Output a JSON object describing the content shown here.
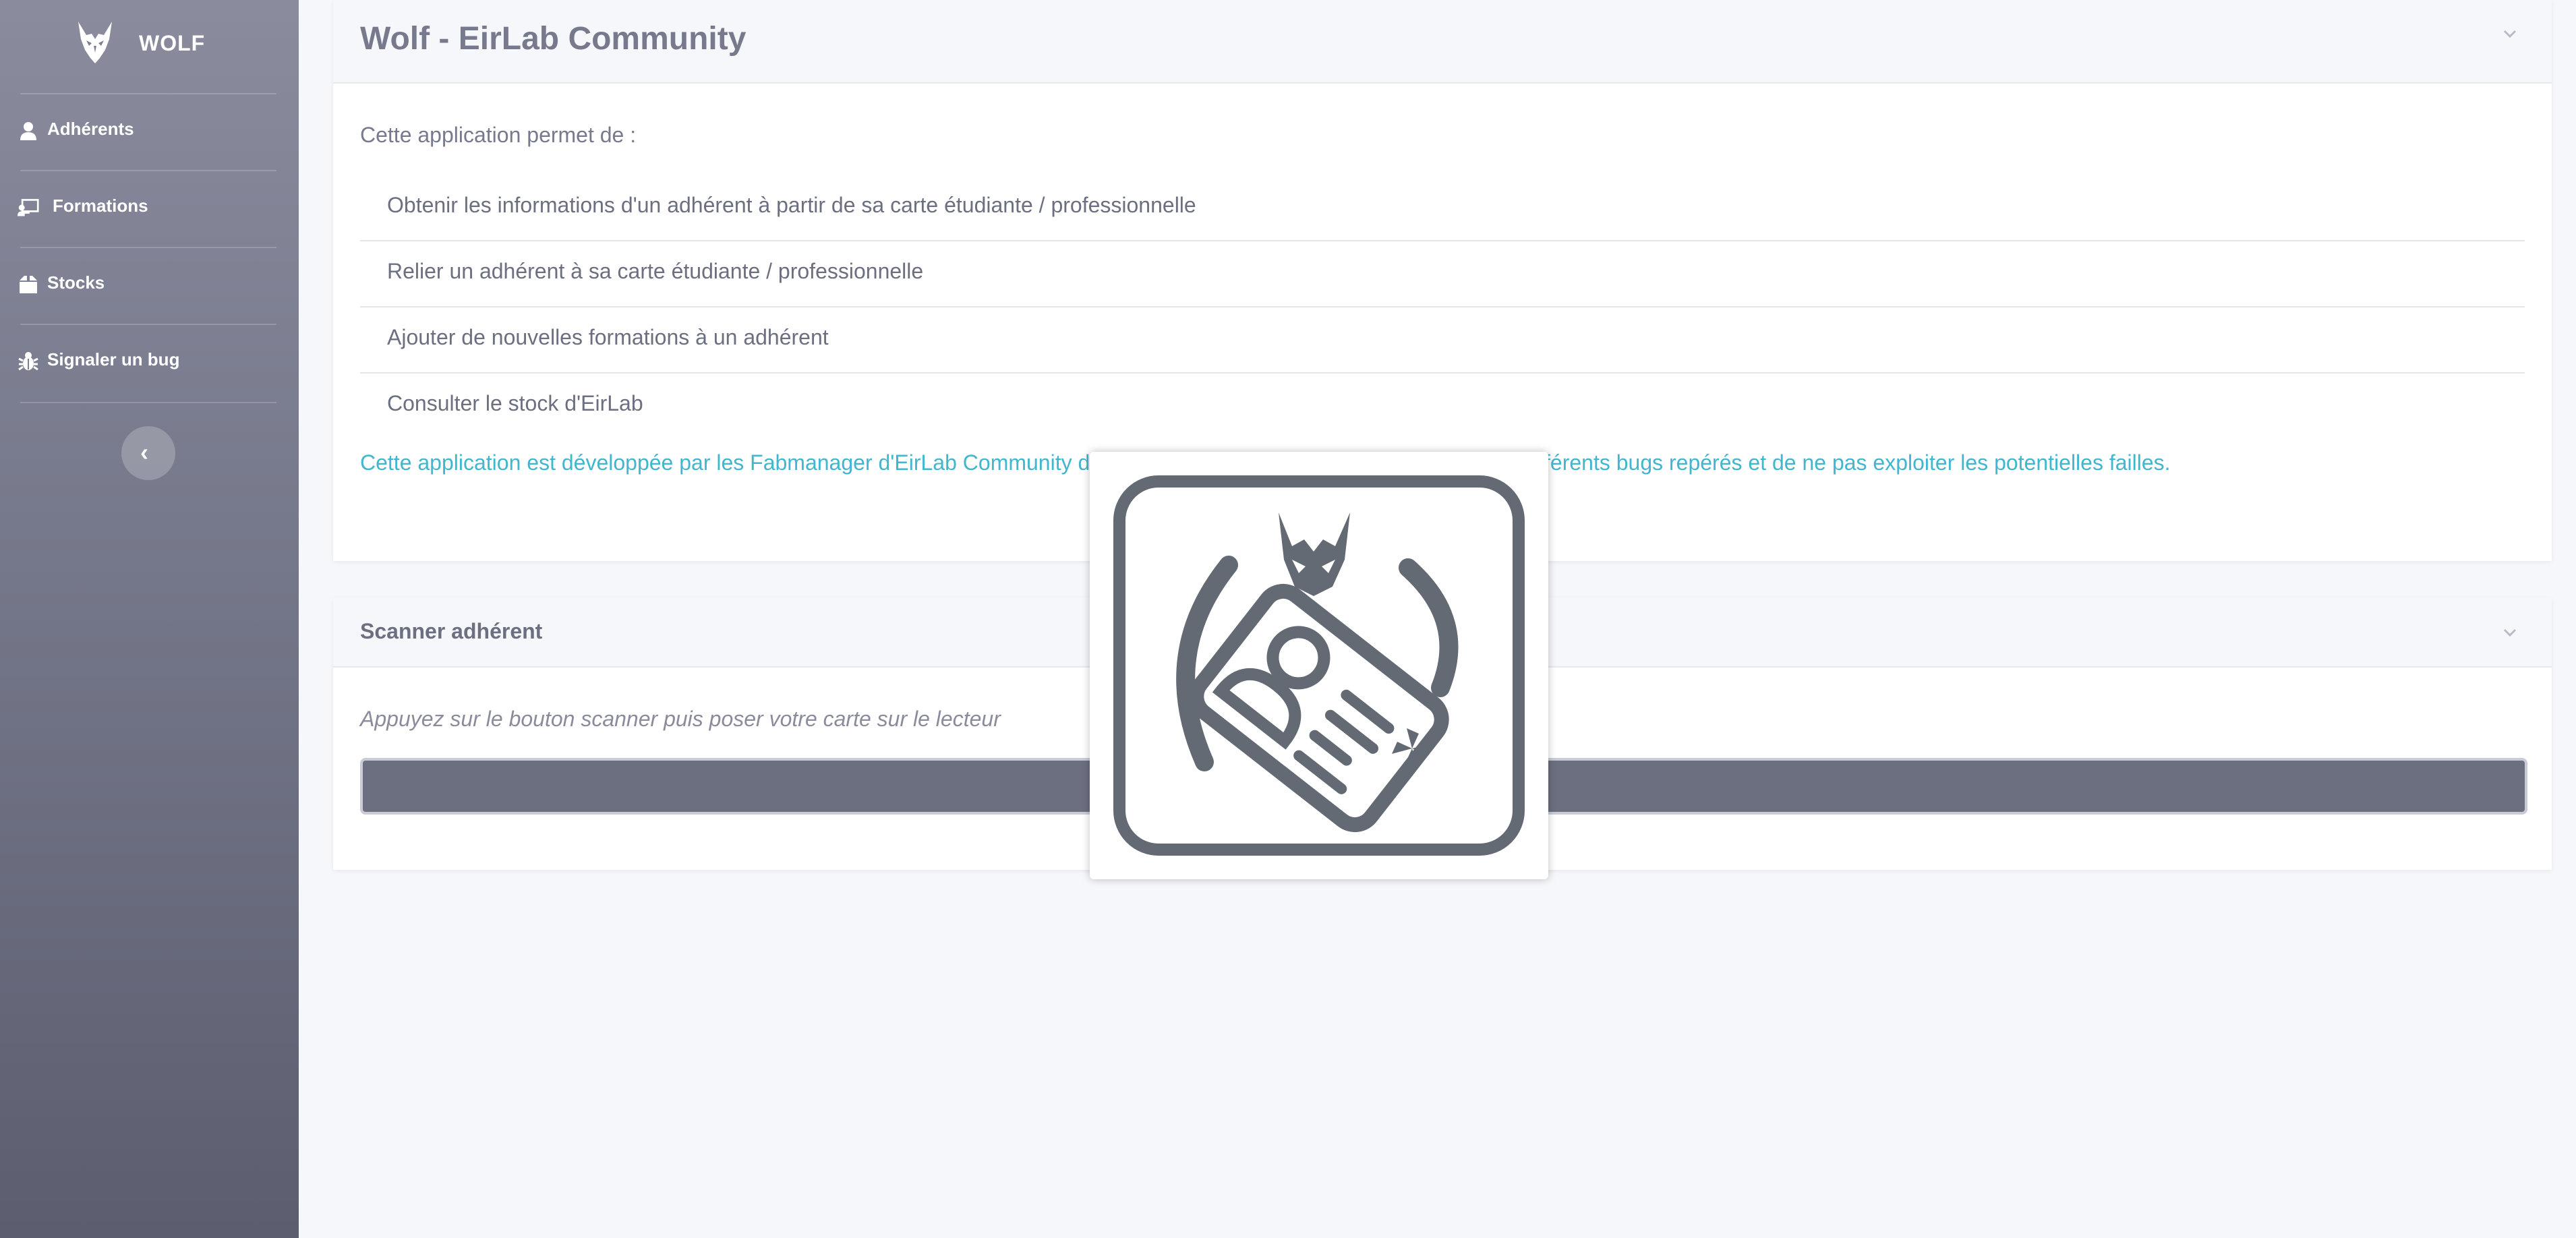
{
  "sidebar": {
    "brand": {
      "name": "WOLF",
      "logo_icon": "wolf-logo-icon"
    },
    "items": [
      {
        "label": "Adhérents",
        "icon": "user-icon"
      },
      {
        "label": "Formations",
        "icon": "chalkboard-teacher-icon"
      },
      {
        "label": "Stocks",
        "icon": "box-icon"
      },
      {
        "label": "Signaler un bug",
        "icon": "bug-icon"
      }
    ],
    "collapse_icon": "chevron-left-icon"
  },
  "info_card": {
    "title": "Wolf - EirLab Community",
    "intro": "Cette application permet de :",
    "features": [
      "Obtenir les informations d'un adhérent à partir de sa carte étudiante / professionnelle",
      "Relier un adhérent à sa carte étudiante / professionnelle",
      "Ajouter de nouvelles formations à un adhérent",
      "Consulter le stock d'EirLab"
    ],
    "notice_visible_left": "Cette application est développée par les Fabmanager d'EirLab Community de",
    "notice_visible_right": "férents bugs repérés et de ne pas exploiter les potentielles failles."
  },
  "scanner_card": {
    "title": "Scanner adhérent",
    "hint": "Appuyez sur le bouton scanner puis poser votre carte sur le lecteur",
    "button_label": ""
  },
  "overlay": {
    "icon": "card-scan-icon"
  },
  "colors": {
    "sidebar_top": "#8a8c9e",
    "sidebar_bottom": "#5c5e70",
    "accent_link": "#41b6cf",
    "button": "#6c6f80",
    "background": "#f6f7fb"
  }
}
